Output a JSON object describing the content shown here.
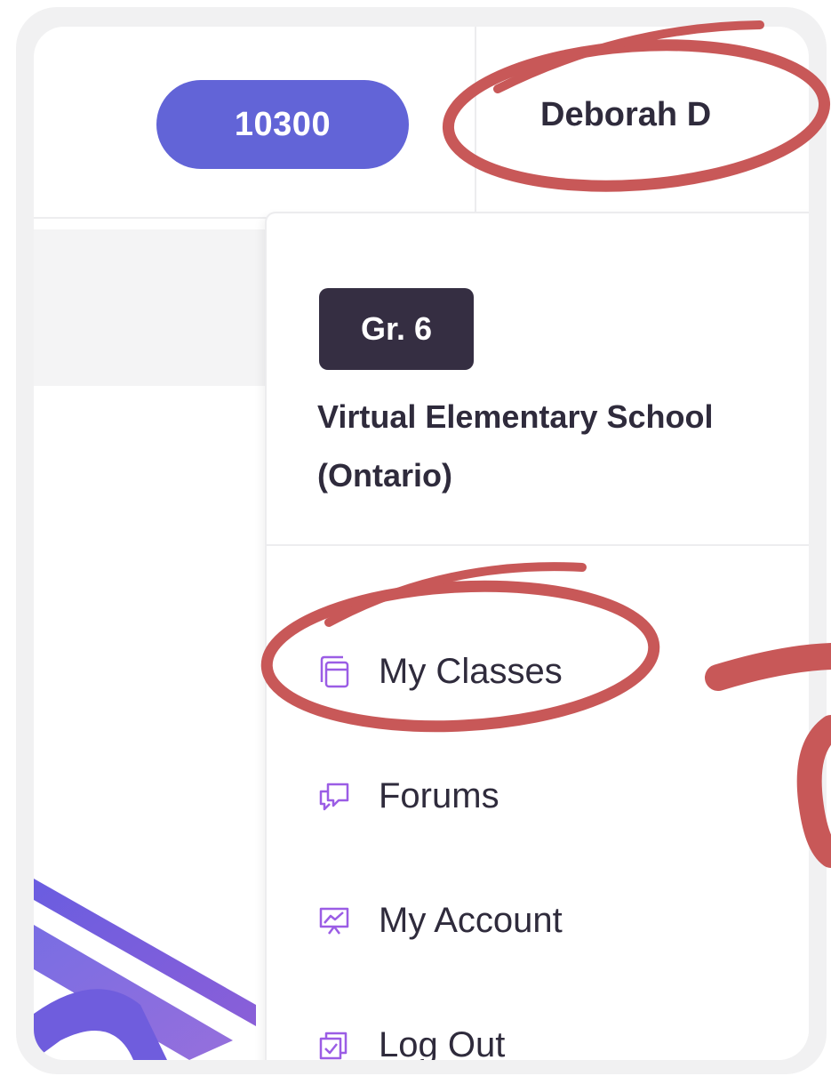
{
  "header": {
    "points": "10300",
    "user_name": "Deborah D"
  },
  "profile": {
    "grade": "Gr. 6",
    "school_line1": "Virtual Elementary School",
    "school_line2": "(Ontario)"
  },
  "menu": {
    "items": [
      {
        "label": "My Classes",
        "icon": "classes-icon"
      },
      {
        "label": "Forums",
        "icon": "forums-icon"
      },
      {
        "label": "My Account",
        "icon": "account-icon"
      },
      {
        "label": "Log Out",
        "icon": "logout-icon"
      }
    ]
  },
  "colors": {
    "accent": "#6264d7",
    "icon_purple": "#9b5de5",
    "grade_badge": "#352e42",
    "annotation": "#c85858",
    "text_dark": "#2f2b3c"
  }
}
